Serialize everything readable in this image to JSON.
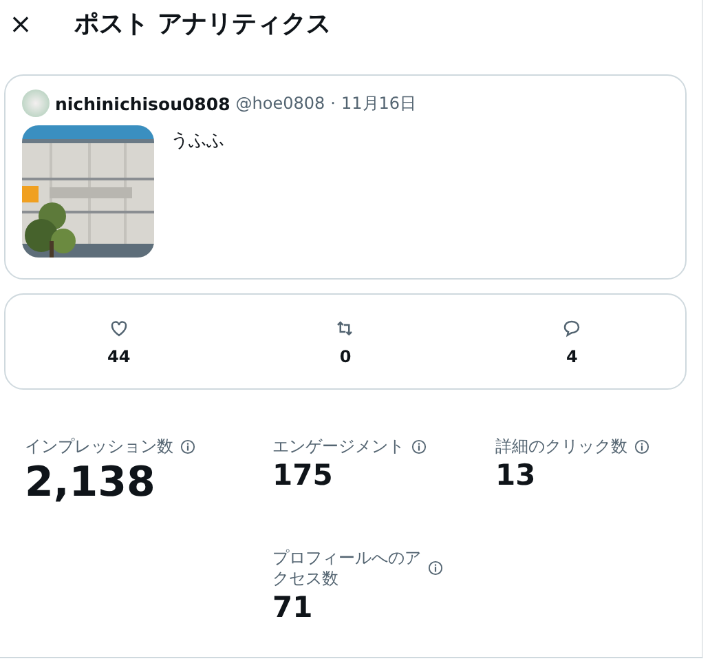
{
  "header": {
    "close": "×",
    "title": "ポスト アナリティクス"
  },
  "post": {
    "display_name": "nichinichisou0808",
    "handle": "@hoe0808",
    "separator": "·",
    "date": "11月16日",
    "text": "うふふ"
  },
  "engagement": [
    {
      "kind": "like",
      "count": "44"
    },
    {
      "kind": "repost",
      "count": "0"
    },
    {
      "kind": "reply",
      "count": "4"
    }
  ],
  "metrics": [
    {
      "label": "インプレッション数",
      "value": "2,138",
      "kind": "headline"
    },
    {
      "label": "エンゲージメント",
      "value": "175",
      "kind": "standard"
    },
    {
      "label": "詳細のクリック数",
      "value": "13",
      "kind": "standard"
    },
    {
      "label": "プロフィールへのアクセス数",
      "value": "71",
      "kind": "standard"
    }
  ]
}
